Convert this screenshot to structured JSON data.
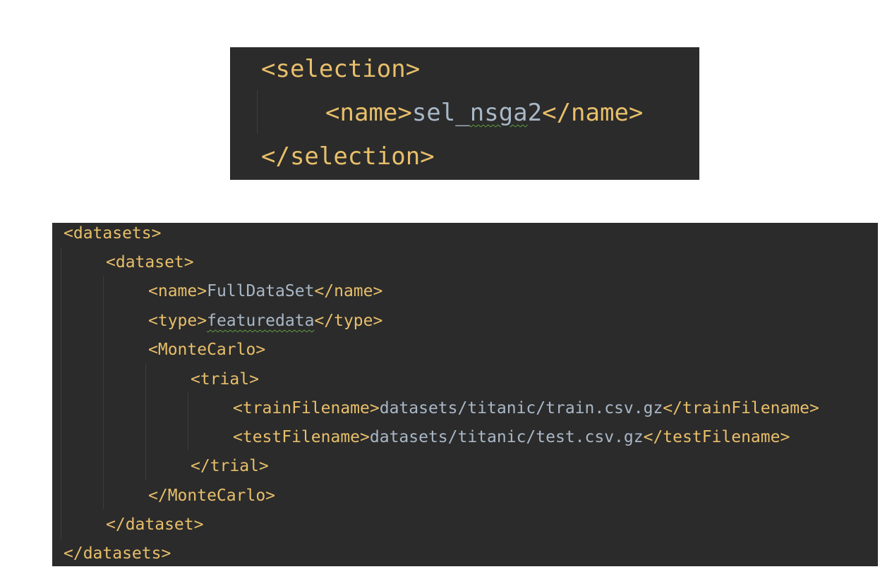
{
  "snippet_selection": {
    "lines": [
      {
        "open": "<selection>"
      },
      {
        "open": "<name>",
        "value": "sel_nsga2",
        "close": "</name>"
      },
      {
        "close": "</selection>"
      }
    ]
  },
  "snippet_datasets": {
    "lines": [
      {
        "open": "<datasets>"
      },
      {
        "open": "<dataset>"
      },
      {
        "open": "<name>",
        "value": "FullDataSet",
        "close": "</name>"
      },
      {
        "open": "<type>",
        "value": "featuredata",
        "close": "</type>"
      },
      {
        "open": "<MonteCarlo>"
      },
      {
        "open": "<trial>"
      },
      {
        "open": "<trainFilename>",
        "value": "datasets/titanic/train.csv.gz",
        "close": "</trainFilename>"
      },
      {
        "open": "<testFilename>",
        "value": "datasets/titanic/test.csv.gz",
        "close": "</testFilename>"
      },
      {
        "close": "</trial>"
      },
      {
        "close": "</MonteCarlo>"
      },
      {
        "close": "</dataset>"
      },
      {
        "close": "</datasets>"
      }
    ]
  },
  "colors": {
    "editor_background": "#2b2b2b",
    "tag": "#e8bf6a",
    "text": "#a9b7c6",
    "spellcheck_underline": "#5f9e3f"
  }
}
